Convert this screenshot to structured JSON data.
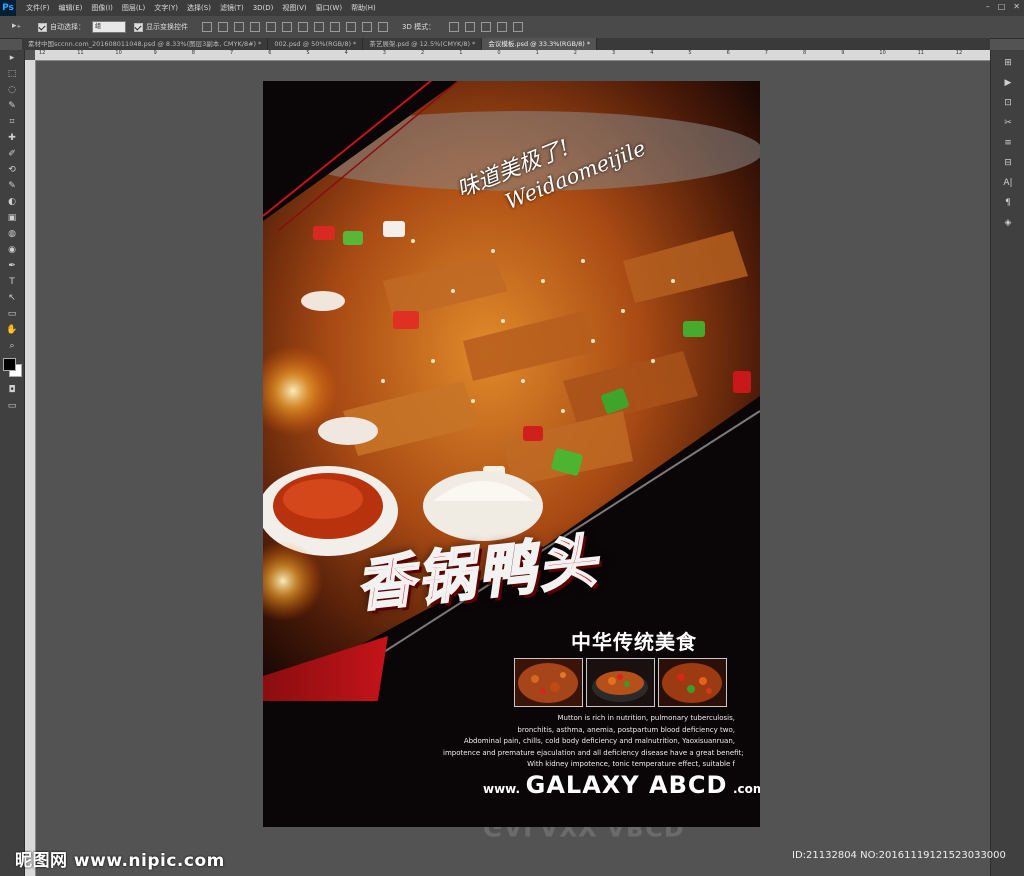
{
  "app": {
    "name": "Ps"
  },
  "menubar": {
    "items": [
      "文件(F)",
      "编辑(E)",
      "图像(I)",
      "图层(L)",
      "文字(Y)",
      "选择(S)",
      "滤镜(T)",
      "3D(D)",
      "视图(V)",
      "窗口(W)",
      "帮助(H)"
    ]
  },
  "window_controls": [
    "–",
    "□",
    "✕"
  ],
  "options": {
    "tool_glyph": "▸₊",
    "auto_select_label": "自动选择：",
    "auto_select_value": "组",
    "show_transform_label": "显示变换控件",
    "mode3d_label": "3D 模式："
  },
  "tabs": [
    {
      "label": "素材中国sccnn.com_201608011048.psd @ 8.33%(图层3副本, CMYK/8#) *",
      "active": false
    },
    {
      "label": "002.psd @ 50%(RGB/8) *",
      "active": false
    },
    {
      "label": "茶艺展架.psd @ 12.5%(CMYK/8) *",
      "active": false
    },
    {
      "label": "会议模板.psd @ 33.3%(RGB/8) *",
      "active": true
    }
  ],
  "ruler": {
    "top_marks": [
      "12",
      "11",
      "10",
      "9",
      "8",
      "7",
      "6",
      "5",
      "4",
      "3",
      "2",
      "1",
      "0",
      "1",
      "2",
      "3",
      "4",
      "5",
      "6",
      "7",
      "8",
      "9",
      "10",
      "11",
      "12"
    ]
  },
  "tools": {
    "glyphs": [
      "▸",
      "⬚",
      "◌",
      "✎",
      "⌗",
      "✚",
      "✐",
      "⟲",
      "✎",
      "◐",
      "▣",
      "◍",
      "◉",
      "✒",
      "T",
      "↖",
      "▭",
      "✋",
      "⌕"
    ]
  },
  "rightdock": {
    "glyphs": [
      "⊞",
      "▶",
      "⊡",
      "✂",
      "≡",
      "⊟",
      "A|",
      "¶",
      "◈"
    ]
  },
  "poster": {
    "slogan_cn": "味道美极了!",
    "slogan_en": "Weidaomeijile",
    "title": "香锅鸭头",
    "subtitle": "中华传统美食",
    "description": [
      "Mutton is rich in nutrition, pulmonary tuberculosis,",
      "bronchitis, asthma, anemia, postpartum blood deficiency two,",
      "Abdominal pain, chills, cold body deficiency and malnutrition, Yaoxisuanruan,",
      "impotence and premature ejaculation and all deficiency disease have a great benefit;",
      "With kidney impotence, tonic temperature effect, suitable f"
    ],
    "website": {
      "prefix": "www.",
      "name": "GALAXY ABCD",
      "suffix": ".com"
    }
  },
  "watermark": {
    "left": "昵图网 www.nipic.com",
    "right": "ID:21132804 NO:20161119121523033000"
  }
}
